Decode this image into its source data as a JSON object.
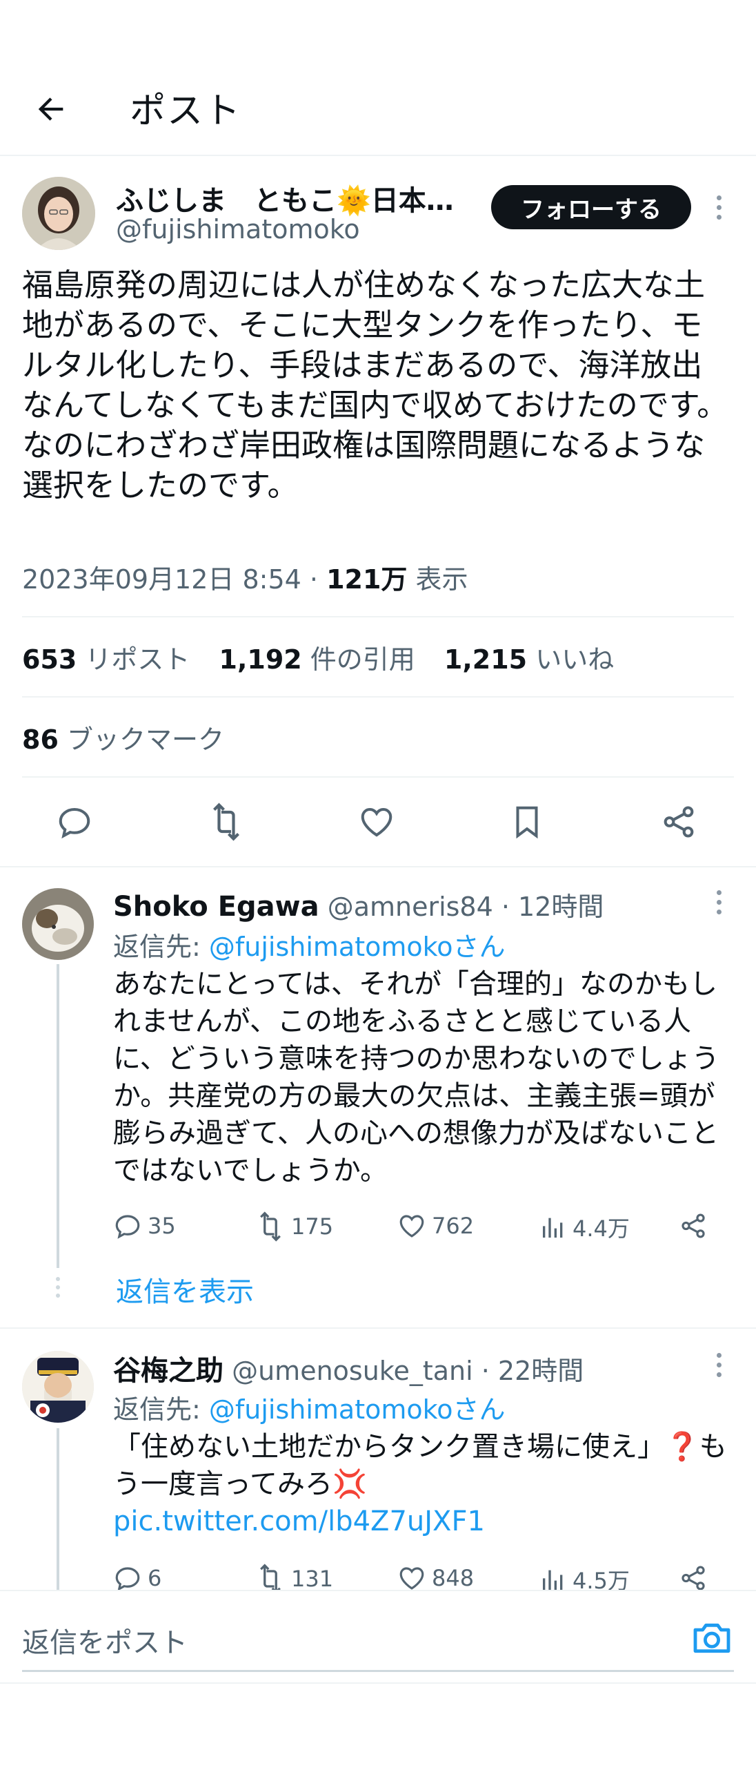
{
  "header": {
    "title": "ポスト"
  },
  "post": {
    "display_name": "ふじしま　ともこ🌞日本…",
    "handle": "@fujishimatomoko",
    "follow_label": "フォローする",
    "text": "福島原発の周辺には人が住めなくなった広大な土地があるので、そこに大型タンクを作ったり、モルタル化したり、手段はまだあるので、海洋放出なんてしなくてもまだ国内で収めておけたのです。なのにわざわざ岸田政権は国際問題になるような選択をしたのです。",
    "datetime": "2023年09月12日 8:54 · ",
    "views_count": "121万",
    "views_label": " 表示",
    "reposts_count": "653",
    "reposts_label": " リポスト",
    "quotes_count": "1,192",
    "quotes_label": " 件の引用",
    "likes_count": "1,215",
    "likes_label": " いいね",
    "bookmarks_count": "86",
    "bookmarks_label": " ブックマーク"
  },
  "replies": [
    {
      "name": "Shoko Egawa",
      "handle": "@amneris84",
      "time": " · 12時間",
      "reply_to_prefix": "返信先: ",
      "reply_to_user": "@fujishimatomokoさん",
      "text": "あなたにとっては、それが「合理的」なのかもしれませんが、この地をふるさとと感じている人に、どういう意味を持つのか思わないのでしょうか。共産党の方の最大の欠点は、主義主張=頭が膨らみ過ぎて、人の心への想像力が及ばないことではないでしょうか。",
      "replies": "35",
      "reposts": "175",
      "likes": "762",
      "views": "4.4万",
      "show_replies": "返信を表示"
    },
    {
      "name": "谷梅之助",
      "handle": "@umenosuke_tani",
      "time": " · 22時間",
      "reply_to_prefix": "返信先: ",
      "reply_to_user": "@fujishimatomokoさん",
      "text_main": "「住めない土地だからタンク置き場に使え」❓もう一度言ってみろ💢 ",
      "text_link": "pic.twitter.com/lb4Z7uJXF1",
      "replies": "6",
      "reposts": "131",
      "likes": "848",
      "views": "4.5万"
    }
  ],
  "composer": {
    "placeholder": "返信をポスト"
  },
  "colors": {
    "accent": "#1d9bf0",
    "text": "#0f1419",
    "muted": "#536471",
    "divider": "#eff3f4"
  }
}
